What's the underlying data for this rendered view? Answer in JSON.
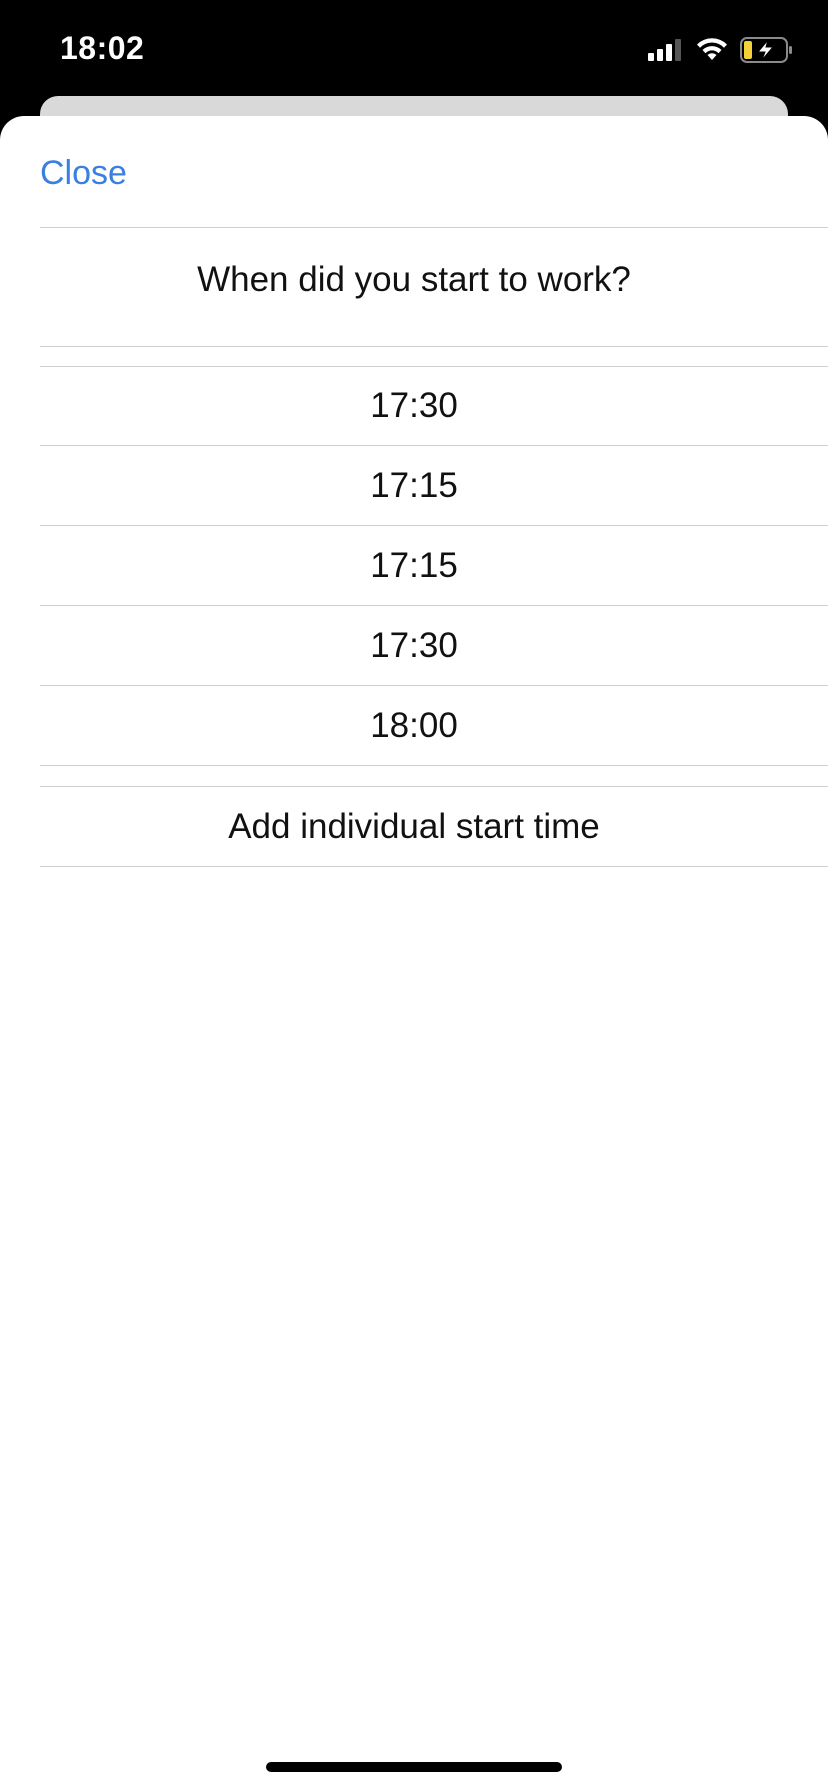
{
  "status_bar": {
    "time": "18:02",
    "signal_icon": "cellular-signal-icon",
    "wifi_icon": "wifi-icon",
    "battery_icon": "battery-charging-icon",
    "battery_accent": "#f2d13b"
  },
  "header": {
    "close_label": "Close",
    "accent_color": "#3a7fe2"
  },
  "question": "When did you start to work?",
  "time_options": [
    {
      "label": "17:30"
    },
    {
      "label": "17:15"
    },
    {
      "label": "17:15"
    },
    {
      "label": "17:30"
    },
    {
      "label": "18:00"
    }
  ],
  "add_individual_label": "Add individual start time"
}
